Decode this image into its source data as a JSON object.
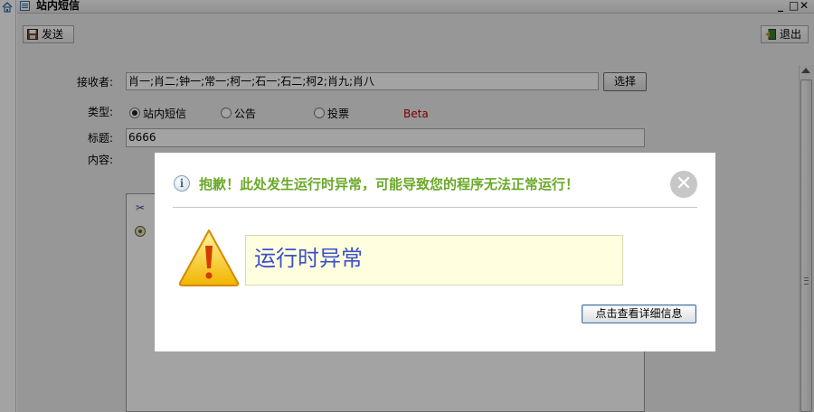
{
  "window": {
    "title": "站内短信",
    "minimize": "_",
    "maximize": "□",
    "close": "✕"
  },
  "toolbar": {
    "send_label": "发送",
    "exit_label": "退出"
  },
  "form": {
    "recipients_label": "接收者:",
    "recipients_value": "肖一;肖二;钟一;常一;柯一;石一;石二;柯2;肖九;肖八",
    "pick_button": "选择",
    "type_label": "类型:",
    "type_options": [
      "站内短信",
      "公告",
      "投票"
    ],
    "type_selected": "站内短信",
    "beta_label": "Beta",
    "title_label": "标题:",
    "title_value": "6666",
    "content_label": "内容:"
  },
  "dialog": {
    "message": "抱歉！此处发生运行时异常，可能导致您的程序无法正常运行！",
    "close_glyph": "✕",
    "error_title": "运行时异常",
    "detail_button": "点击查看详细信息"
  },
  "icons": [
    "home-icon",
    "window-icon",
    "save-icon",
    "exit-icon",
    "info-icon",
    "warning-icon",
    "cut-icon",
    "image-icon"
  ],
  "colors": {
    "dialog_message": "#6aa829",
    "error_text": "#3c4fc8",
    "error_box": "#ffffe0",
    "beta": "#c00000"
  }
}
